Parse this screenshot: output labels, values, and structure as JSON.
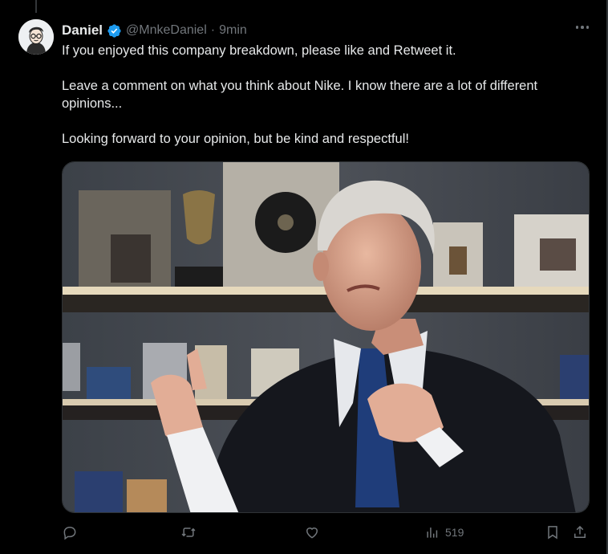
{
  "tweet": {
    "author_name": "Daniel",
    "handle": "@MnkeDaniel",
    "separator": "·",
    "time": "9min",
    "paragraphs": [
      "If you enjoyed this company breakdown, please like and Retweet it.",
      "Leave a comment on what you think about Nike. I know there are a lot of different opinions...",
      "Looking forward to your opinion, but be kind and respectful!"
    ],
    "views": "519"
  },
  "colors": {
    "verified": "#1d9bf0",
    "muted": "#71767b",
    "text": "#e7e9ea"
  },
  "icons": [
    "verified-badge-icon",
    "more-icon",
    "reply-icon",
    "retweet-icon",
    "like-icon",
    "views-icon",
    "bookmark-icon",
    "share-icon"
  ]
}
